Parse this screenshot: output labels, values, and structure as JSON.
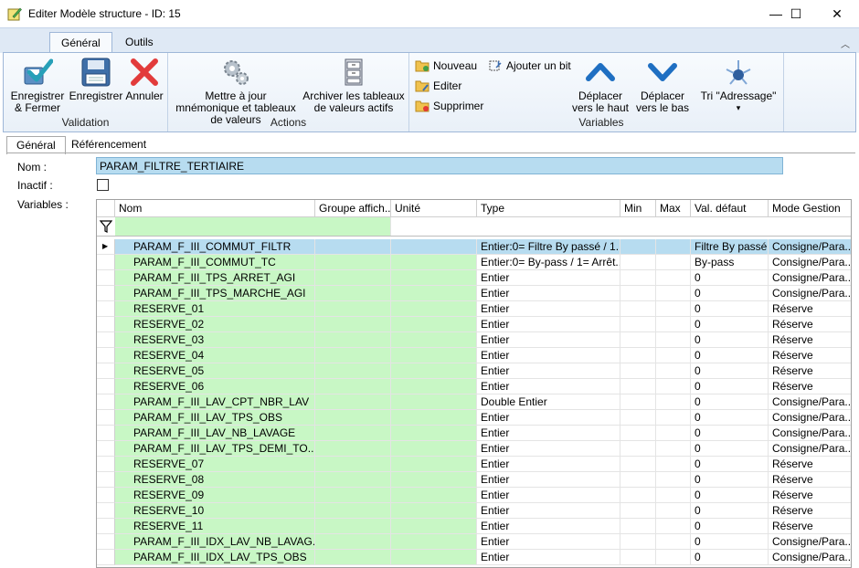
{
  "window": {
    "title": "Editer Modèle structure - ID: 15",
    "minimize": "—",
    "maximize": "☐",
    "close": "✕"
  },
  "ribbon_tabs": [
    {
      "label": "Général",
      "active": true
    },
    {
      "label": "Outils",
      "active": false
    }
  ],
  "ribbon": {
    "groups": {
      "validation": "Validation",
      "actions": "Actions",
      "variables": "Variables"
    },
    "save_close": "Enregistrer & Fermer",
    "save": "Enregistrer",
    "cancel": "Annuler",
    "update_mnemonic": "Mettre à jour mnémonique et tableaux de valeurs",
    "archive_tables": "Archiver les tableaux de valeurs actifs",
    "new": "Nouveau",
    "edit": "Editer",
    "delete": "Supprimer",
    "add_bit": "Ajouter un bit",
    "move_up": "Déplacer vers le haut",
    "move_down": "Déplacer vers le bas",
    "sort_address": "Tri \"Adressage\"",
    "sort_arrow": "▾"
  },
  "doc_tabs": [
    {
      "label": "Général",
      "active": true
    },
    {
      "label": "Référencement",
      "active": false
    }
  ],
  "form": {
    "name_label": "Nom :",
    "name_value": "PARAM_FILTRE_TERTIAIRE",
    "inactive_label": "Inactif :",
    "inactive_checked": false,
    "variables_label": "Variables :"
  },
  "grid": {
    "columns": [
      "Nom",
      "Groupe affich...",
      "Unité",
      "Type",
      "Min",
      "Max",
      "Val. défaut",
      "Mode Gestion"
    ],
    "filter_icon": "funnel-icon",
    "current_row_marker": "▶",
    "rows": [
      [
        "PARAM_F_III_COMMUT_FILTR",
        "",
        "",
        "Entier:0= Filtre By passé / 1...",
        "",
        "",
        "Filtre By passé",
        "Consigne/Para..."
      ],
      [
        "PARAM_F_III_COMMUT_TC",
        "",
        "",
        "Entier:0= By-pass / 1= Arrêt...",
        "",
        "",
        "By-pass",
        "Consigne/Para..."
      ],
      [
        "PARAM_F_III_TPS_ARRET_AGI",
        "",
        "",
        "Entier",
        "",
        "",
        "0",
        "Consigne/Para..."
      ],
      [
        "PARAM_F_III_TPS_MARCHE_AGI",
        "",
        "",
        "Entier",
        "",
        "",
        "0",
        "Consigne/Para..."
      ],
      [
        "RESERVE_01",
        "",
        "",
        "Entier",
        "",
        "",
        "0",
        "Réserve"
      ],
      [
        "RESERVE_02",
        "",
        "",
        "Entier",
        "",
        "",
        "0",
        "Réserve"
      ],
      [
        "RESERVE_03",
        "",
        "",
        "Entier",
        "",
        "",
        "0",
        "Réserve"
      ],
      [
        "RESERVE_04",
        "",
        "",
        "Entier",
        "",
        "",
        "0",
        "Réserve"
      ],
      [
        "RESERVE_05",
        "",
        "",
        "Entier",
        "",
        "",
        "0",
        "Réserve"
      ],
      [
        "RESERVE_06",
        "",
        "",
        "Entier",
        "",
        "",
        "0",
        "Réserve"
      ],
      [
        "PARAM_F_III_LAV_CPT_NBR_LAV",
        "",
        "",
        "Double Entier",
        "",
        "",
        "0",
        "Consigne/Para..."
      ],
      [
        "PARAM_F_III_LAV_TPS_OBS",
        "",
        "",
        "Entier",
        "",
        "",
        "0",
        "Consigne/Para..."
      ],
      [
        "PARAM_F_III_LAV_NB_LAVAGE",
        "",
        "",
        "Entier",
        "",
        "",
        "0",
        "Consigne/Para..."
      ],
      [
        "PARAM_F_III_LAV_TPS_DEMI_TO...",
        "",
        "",
        "Entier",
        "",
        "",
        "0",
        "Consigne/Para..."
      ],
      [
        "RESERVE_07",
        "",
        "",
        "Entier",
        "",
        "",
        "0",
        "Réserve"
      ],
      [
        "RESERVE_08",
        "",
        "",
        "Entier",
        "",
        "",
        "0",
        "Réserve"
      ],
      [
        "RESERVE_09",
        "",
        "",
        "Entier",
        "",
        "",
        "0",
        "Réserve"
      ],
      [
        "RESERVE_10",
        "",
        "",
        "Entier",
        "",
        "",
        "0",
        "Réserve"
      ],
      [
        "RESERVE_11",
        "",
        "",
        "Entier",
        "",
        "",
        "0",
        "Réserve"
      ],
      [
        "PARAM_F_III_IDX_LAV_NB_LAVAG...",
        "",
        "",
        "Entier",
        "",
        "",
        "0",
        "Consigne/Para..."
      ],
      [
        "PARAM_F_III_IDX_LAV_TPS_OBS",
        "",
        "",
        "Entier",
        "",
        "",
        "0",
        "Consigne/Para..."
      ]
    ]
  },
  "colors": {
    "green_cells": "#c8f7c5",
    "selected_row": "#b7dcf0",
    "ribbon_bg": "#e9f0f8"
  }
}
